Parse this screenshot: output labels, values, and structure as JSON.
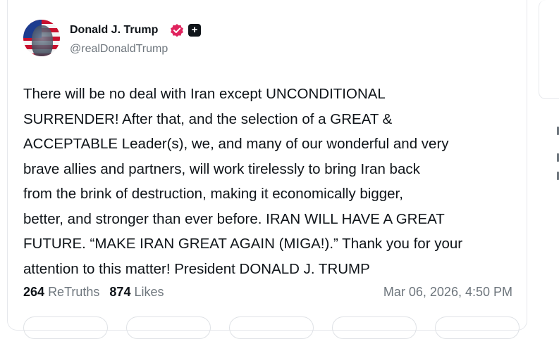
{
  "author": {
    "name": "Donald J. Trump",
    "handle": "@realDonaldTrump",
    "verified_icon": "verified-badge-icon",
    "plus_icon": "plus-badge-icon",
    "badge_color": "#e0245e"
  },
  "post": {
    "lines": [
      "There will be no deal with Iran except UNCONDITIONAL",
      "SURRENDER! After that, and the selection of a GREAT &",
      "ACCEPTABLE Leader(s), we, and many of our wonderful and very",
      "brave allies and partners, will work tirelessly to bring Iran back",
      "from the brink of destruction, making it economically bigger,",
      "better, and stronger than ever before. IRAN WILL HAVE A GREAT",
      "FUTURE. “MAKE IRAN GREAT AGAIN (MIGA!).” Thank you for your",
      "attention to this matter! President DONALD J. TRUMP"
    ]
  },
  "stats": {
    "retruths_count": "264",
    "retruths_label": "ReTruths",
    "likes_count": "874",
    "likes_label": "Likes"
  },
  "timestamp": "Mar 06, 2026, 4:50 PM"
}
